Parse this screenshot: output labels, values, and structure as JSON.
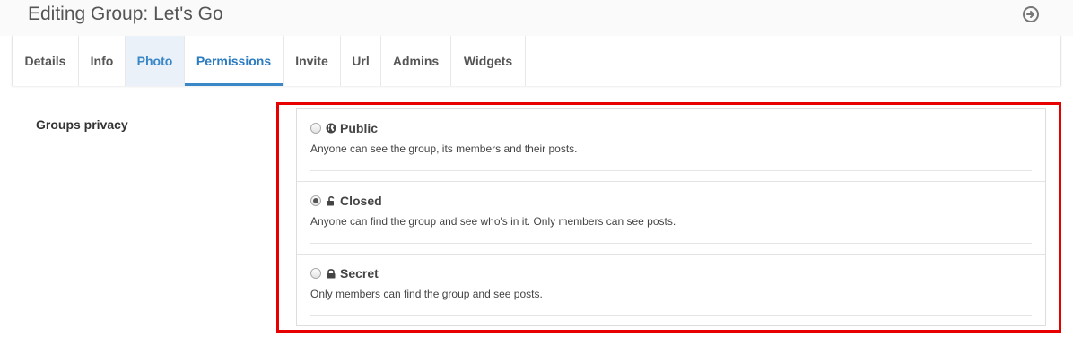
{
  "header": {
    "title": "Editing Group: Let's Go",
    "right_icon": "circle-arrow-right-icon"
  },
  "tabs": [
    {
      "label": "Details"
    },
    {
      "label": "Info"
    },
    {
      "label": "Photo"
    },
    {
      "label": "Permissions"
    },
    {
      "label": "Invite"
    },
    {
      "label": "Url"
    },
    {
      "label": "Admins"
    },
    {
      "label": "Widgets"
    }
  ],
  "active_tab": "Permissions",
  "privacy": {
    "label": "Groups privacy",
    "selected": "Closed",
    "options": [
      {
        "title": "Public",
        "icon": "globe-icon",
        "description": "Anyone can see the group, its members and their posts."
      },
      {
        "title": "Closed",
        "icon": "unlock-icon",
        "description": "Anyone can find the group and see who's in it. Only members can see posts."
      },
      {
        "title": "Secret",
        "icon": "lock-icon",
        "description": "Only members can find the group and see posts."
      }
    ]
  },
  "colors": {
    "accent": "#3a87c8",
    "highlight": "#e60000"
  }
}
